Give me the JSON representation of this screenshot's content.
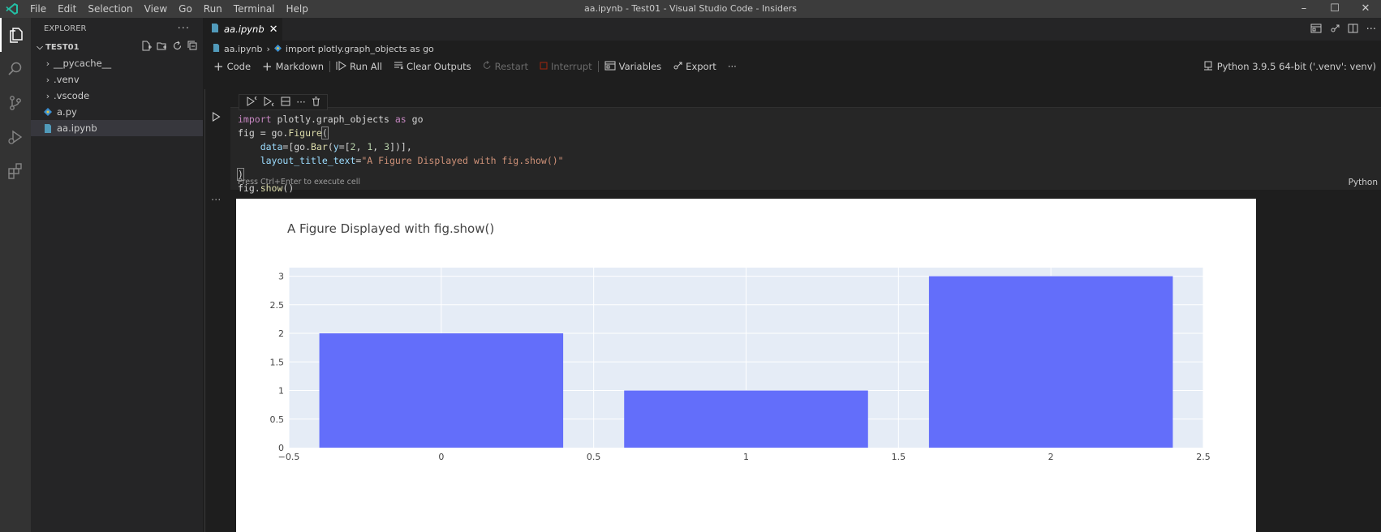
{
  "titlebar": {
    "menu": [
      "File",
      "Edit",
      "Selection",
      "View",
      "Go",
      "Run",
      "Terminal",
      "Help"
    ],
    "window_title": "aa.ipynb - Test01 - Visual Studio Code - Insiders",
    "controls": [
      "–",
      "☐",
      "✕"
    ]
  },
  "sidebar": {
    "header": "EXPLORER",
    "header_more": "···",
    "project": "TEST01",
    "items": [
      {
        "label": "__pycache__",
        "kind": "folder"
      },
      {
        "label": ".venv",
        "kind": "folder"
      },
      {
        "label": ".vscode",
        "kind": "folder"
      },
      {
        "label": "a.py",
        "kind": "python"
      },
      {
        "label": "aa.ipynb",
        "kind": "notebook"
      }
    ]
  },
  "editor": {
    "tab_label": "aa.ipynb",
    "tab_close": "✕",
    "breadcrumb": [
      "aa.ipynb",
      "import plotly.graph_objects as go"
    ],
    "breadcrumb_sep": "›",
    "toolbar": {
      "code": "Code",
      "markdown": "Markdown",
      "run_all": "Run All",
      "clear_outputs": "Clear Outputs",
      "restart": "Restart",
      "interrupt": "Interrupt",
      "variables": "Variables",
      "export": "Export",
      "more": "···"
    },
    "kernel": "Python 3.9.5 64-bit ('.venv': venv)"
  },
  "cell": {
    "status": "Press Ctrl+Enter to execute cell",
    "language": "Python",
    "output_dots": "···"
  },
  "colors": {
    "accent": "#007acc",
    "bar": "#636efa",
    "plot_bg": "#e5ecf6"
  },
  "chart_data": {
    "type": "bar",
    "title": "A Figure Displayed with fig.show()",
    "x": [
      0,
      1,
      2
    ],
    "values": [
      2,
      1,
      3
    ],
    "xlim": [
      -0.5,
      2.5
    ],
    "ylim": [
      0,
      3.15
    ],
    "xticks": [
      "−0.5",
      "0",
      "0.5",
      "1",
      "1.5",
      "2",
      "2.5"
    ],
    "xtick_values": [
      -0.5,
      0,
      0.5,
      1,
      1.5,
      2,
      2.5
    ],
    "yticks": [
      "0",
      "0.5",
      "1",
      "1.5",
      "2",
      "2.5",
      "3"
    ],
    "ytick_values": [
      0,
      0.5,
      1,
      1.5,
      2,
      2.5,
      3
    ],
    "grid": true
  }
}
